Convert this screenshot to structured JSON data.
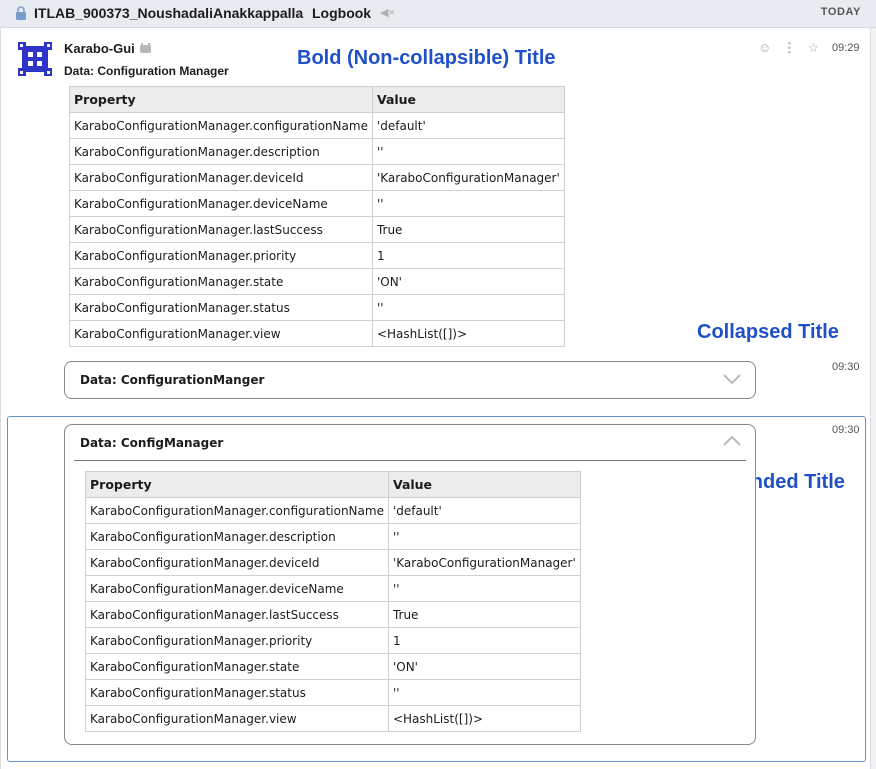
{
  "header": {
    "workspace": "ITLAB_900373_NoushadaliAnakkappalla",
    "channel": "Logbook",
    "date_label": "TODAY",
    "icons": [
      "lock-icon",
      "mute-icon"
    ]
  },
  "message": {
    "sender": "Karabo-Gui",
    "time": "09:29",
    "title": "Data: Configuration Manager",
    "actions": [
      "emoji-icon",
      "more-icon",
      "star-icon"
    ]
  },
  "annotations": {
    "bold": "Bold (Non-collapsible) Title",
    "collapsed": "Collapsed Title",
    "expanded": "Expanded Title"
  },
  "table_headers": {
    "property": "Property",
    "value": "Value"
  },
  "table1": [
    {
      "property": "KaraboConfigurationManager.configurationName",
      "value": "'default'"
    },
    {
      "property": "KaraboConfigurationManager.description",
      "value": "''"
    },
    {
      "property": "KaraboConfigurationManager.deviceId",
      "value": "'KaraboConfigurationManager'"
    },
    {
      "property": "KaraboConfigurationManager.deviceName",
      "value": "''"
    },
    {
      "property": "KaraboConfigurationManager.lastSuccess",
      "value": "True"
    },
    {
      "property": "KaraboConfigurationManager.priority",
      "value": "1"
    },
    {
      "property": "KaraboConfigurationManager.state",
      "value": "'ON'"
    },
    {
      "property": "KaraboConfigurationManager.status",
      "value": "''"
    },
    {
      "property": "KaraboConfigurationManager.view",
      "value": "<HashList([])>"
    }
  ],
  "collapsed_block": {
    "title": "Data: ConfigurationManger",
    "time": "09:30",
    "state": "collapsed"
  },
  "expanded_block": {
    "title": "Data: ConfigManager",
    "time": "09:30",
    "state": "expanded"
  },
  "table2": [
    {
      "property": "KaraboConfigurationManager.configurationName",
      "value": "'default'"
    },
    {
      "property": "KaraboConfigurationManager.description",
      "value": "''"
    },
    {
      "property": "KaraboConfigurationManager.deviceId",
      "value": "'KaraboConfigurationManager'"
    },
    {
      "property": "KaraboConfigurationManager.deviceName",
      "value": "''"
    },
    {
      "property": "KaraboConfigurationManager.lastSuccess",
      "value": "True"
    },
    {
      "property": "KaraboConfigurationManager.priority",
      "value": "1"
    },
    {
      "property": "KaraboConfigurationManager.state",
      "value": "'ON'"
    },
    {
      "property": "KaraboConfigurationManager.status",
      "value": "''"
    },
    {
      "property": "KaraboConfigurationManager.view",
      "value": "<HashList([])>"
    }
  ]
}
